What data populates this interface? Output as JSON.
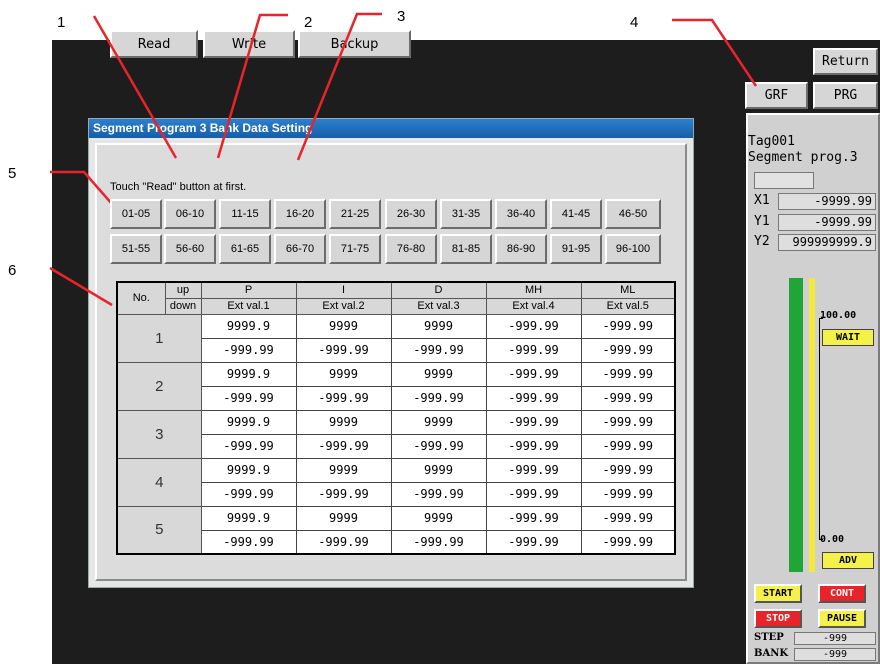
{
  "callouts": [
    "1",
    "2",
    "3",
    "4",
    "5",
    "6"
  ],
  "nav": {
    "return_label": "Return",
    "grf_label": "GRF",
    "prg_label": "PRG"
  },
  "window": {
    "title": "Segment Program 3 Bank Data Setting",
    "buttons": {
      "read": "Read",
      "write": "Write",
      "backup": "Backup"
    },
    "hint": "Touch \"Read\" button at first.",
    "ranges": [
      "01-05",
      "06-10",
      "11-15",
      "16-20",
      "21-25",
      "26-30",
      "31-35",
      "36-40",
      "41-45",
      "46-50",
      "51-55",
      "56-60",
      "61-65",
      "66-70",
      "71-75",
      "76-80",
      "81-85",
      "86-90",
      "91-95",
      "96-100"
    ]
  },
  "table": {
    "no_header": "No.",
    "up_label": "up",
    "down_label": "down",
    "columns": [
      {
        "name": "P",
        "sub": "Ext val.1"
      },
      {
        "name": "I",
        "sub": "Ext val.2"
      },
      {
        "name": "D",
        "sub": "Ext val.3"
      },
      {
        "name": "MH",
        "sub": "Ext val.4"
      },
      {
        "name": "ML",
        "sub": "Ext val.5"
      }
    ],
    "rows": [
      {
        "no": "1",
        "up": [
          "9999.9",
          "9999",
          "9999",
          "-999.99",
          "-999.99"
        ],
        "down": [
          "-999.99",
          "-999.99",
          "-999.99",
          "-999.99",
          "-999.99"
        ]
      },
      {
        "no": "2",
        "up": [
          "9999.9",
          "9999",
          "9999",
          "-999.99",
          "-999.99"
        ],
        "down": [
          "-999.99",
          "-999.99",
          "-999.99",
          "-999.99",
          "-999.99"
        ]
      },
      {
        "no": "3",
        "up": [
          "9999.9",
          "9999",
          "9999",
          "-999.99",
          "-999.99"
        ],
        "down": [
          "-999.99",
          "-999.99",
          "-999.99",
          "-999.99",
          "-999.99"
        ]
      },
      {
        "no": "4",
        "up": [
          "9999.9",
          "9999",
          "9999",
          "-999.99",
          "-999.99"
        ],
        "down": [
          "-999.99",
          "-999.99",
          "-999.99",
          "-999.99",
          "-999.99"
        ]
      },
      {
        "no": "5",
        "up": [
          "9999.9",
          "9999",
          "9999",
          "-999.99",
          "-999.99"
        ],
        "down": [
          "-999.99",
          "-999.99",
          "-999.99",
          "-999.99",
          "-999.99"
        ]
      }
    ]
  },
  "side": {
    "tag": "Tag001",
    "prog": "Segment prog.3",
    "x1_label": "X1",
    "x1_value": "-9999.99",
    "y1_label": "Y1",
    "y1_value": "-9999.99",
    "y2_label": "Y2",
    "y2_value": "999999999.9",
    "scale_max": "100.00",
    "scale_min": "0.00",
    "wait_label": "WAIT",
    "adv_label": "ADV",
    "start_label": "START",
    "cont_label": "CONT",
    "stop_label": "STOP",
    "pause_label": "PAUSE",
    "step_label": "STEP",
    "step_value": "-999",
    "bank_label": "BANK",
    "bank_value": "-999"
  },
  "colors": {
    "callout_line": "#e8242a",
    "title_bar": "#1a68b8",
    "bar_green": "#1fa637",
    "bar_yellow": "#f3e93a",
    "start_btn": "#f5f04a",
    "stop_btn": "#e8232a"
  }
}
